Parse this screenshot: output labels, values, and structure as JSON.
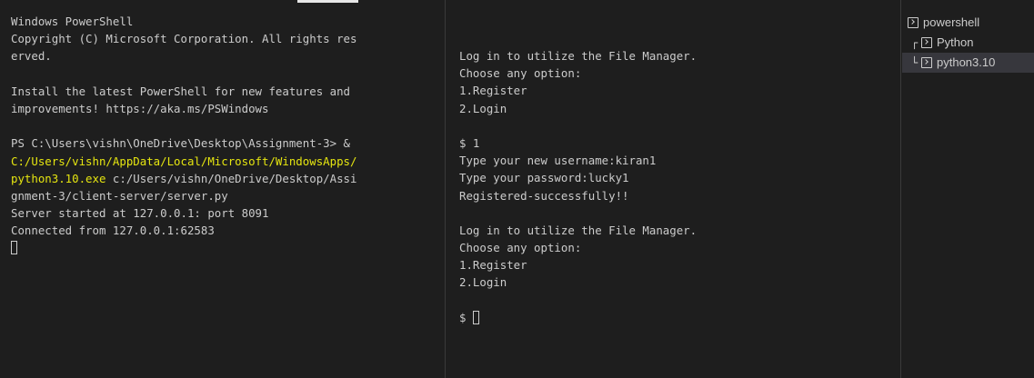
{
  "left_terminal": {
    "lines": [
      {
        "text": "Windows PowerShell"
      },
      {
        "text": "Copyright (C) Microsoft Corporation. All rights res"
      },
      {
        "text": "erved."
      },
      {
        "text": ""
      },
      {
        "text": "Install the latest PowerShell for new features and"
      },
      {
        "text": "improvements! https://aka.ms/PSWindows"
      },
      {
        "text": ""
      },
      {
        "text": "PS C:\\Users\\vishn\\OneDrive\\Desktop\\Assignment-3> &"
      },
      {
        "text": "C:/Users/vishn/AppData/Local/Microsoft/WindowsApps/",
        "color": "yellow"
      },
      {
        "yellow": "python3.10.exe",
        "rest": " c:/Users/vishn/OneDrive/Desktop/Assi"
      },
      {
        "text": "gnment-3/client-server/server.py"
      },
      {
        "text": "Server started at 127.0.0.1: port 8091"
      },
      {
        "text": "Connected from 127.0.0.1:62583"
      }
    ]
  },
  "mid_terminal": {
    "lines": [
      "Log in to utilize the File Manager.",
      "Choose any option:",
      "1.Register",
      "2.Login",
      "",
      "$ 1",
      "Type your new username:kiran1",
      "Type your password:lucky1",
      "Registered-successfully!!",
      "",
      "Log in to utilize the File Manager.",
      "Choose any option:",
      "1.Register",
      "2.Login",
      ""
    ],
    "prompt": "$ "
  },
  "sidebar": {
    "items": [
      {
        "label": "powershell",
        "tree": "",
        "icon": "terminal-icon"
      },
      {
        "label": "Python",
        "tree": "┌",
        "icon": "terminal-icon"
      },
      {
        "label": "python3.10",
        "tree": "└",
        "icon": "terminal-icon",
        "selected": true
      }
    ]
  },
  "colors": {
    "background": "#1e1e1e",
    "text": "#cccccc",
    "yellow": "#e5e510",
    "selected": "#37373d"
  }
}
